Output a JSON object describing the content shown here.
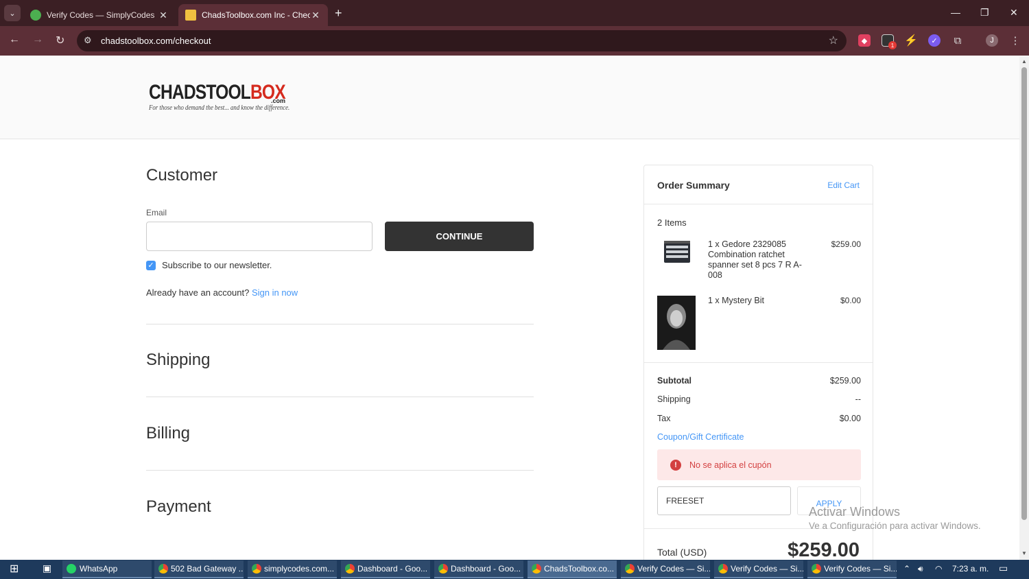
{
  "browser": {
    "tabs": [
      {
        "title": "Verify Codes — SimplyCodes",
        "favicon_color": "#4caf50"
      },
      {
        "title": "ChadsToolbox.com Inc - Checkout",
        "favicon_color": "#f0c040"
      }
    ],
    "url": "chadstoolbox.com/checkout",
    "profile_initial": "J",
    "ext_badge": "1"
  },
  "site": {
    "logo_main_black": "CHADSTOOL",
    "logo_main_red": "BOX",
    "logo_com": ".com",
    "logo_tagline": "For those who demand the best... and know the difference."
  },
  "checkout": {
    "customer_heading": "Customer",
    "email_label": "Email",
    "email_value": "",
    "continue_label": "CONTINUE",
    "subscribe_label": "Subscribe to our newsletter.",
    "account_prompt": "Already have an account?",
    "signin_label": "Sign in now",
    "shipping_heading": "Shipping",
    "billing_heading": "Billing",
    "payment_heading": "Payment"
  },
  "summary": {
    "title": "Order Summary",
    "edit_cart": "Edit Cart",
    "items_count": "2 Items",
    "items": [
      {
        "name": "1 x Gedore 2329085 Combination ratchet spanner set 8 pcs 7 R A-008",
        "price": "$259.00"
      },
      {
        "name": "1 x Mystery Bit",
        "price": "$0.00"
      }
    ],
    "subtotal_label": "Subtotal",
    "subtotal_value": "$259.00",
    "shipping_label": "Shipping",
    "shipping_value": "--",
    "tax_label": "Tax",
    "tax_value": "$0.00",
    "coupon_link": "Coupon/Gift Certificate",
    "coupon_error": "No se aplica el cupón",
    "coupon_value": "FREESET",
    "apply_label": "APPLY",
    "total_label": "Total (USD)",
    "total_value": "$259.00"
  },
  "watermark": {
    "line1": "Activar Windows",
    "line2": "Ve a Configuración para activar Windows."
  },
  "taskbar": {
    "items": [
      "WhatsApp",
      "502 Bad Gateway ...",
      "simplycodes.com...",
      "Dashboard - Goo...",
      "Dashboard - Goo...",
      "ChadsToolbox.co...",
      "Verify Codes — Si...",
      "Verify Codes — Si...",
      "Verify Codes — Si..."
    ],
    "clock": "7:23 a. m."
  }
}
